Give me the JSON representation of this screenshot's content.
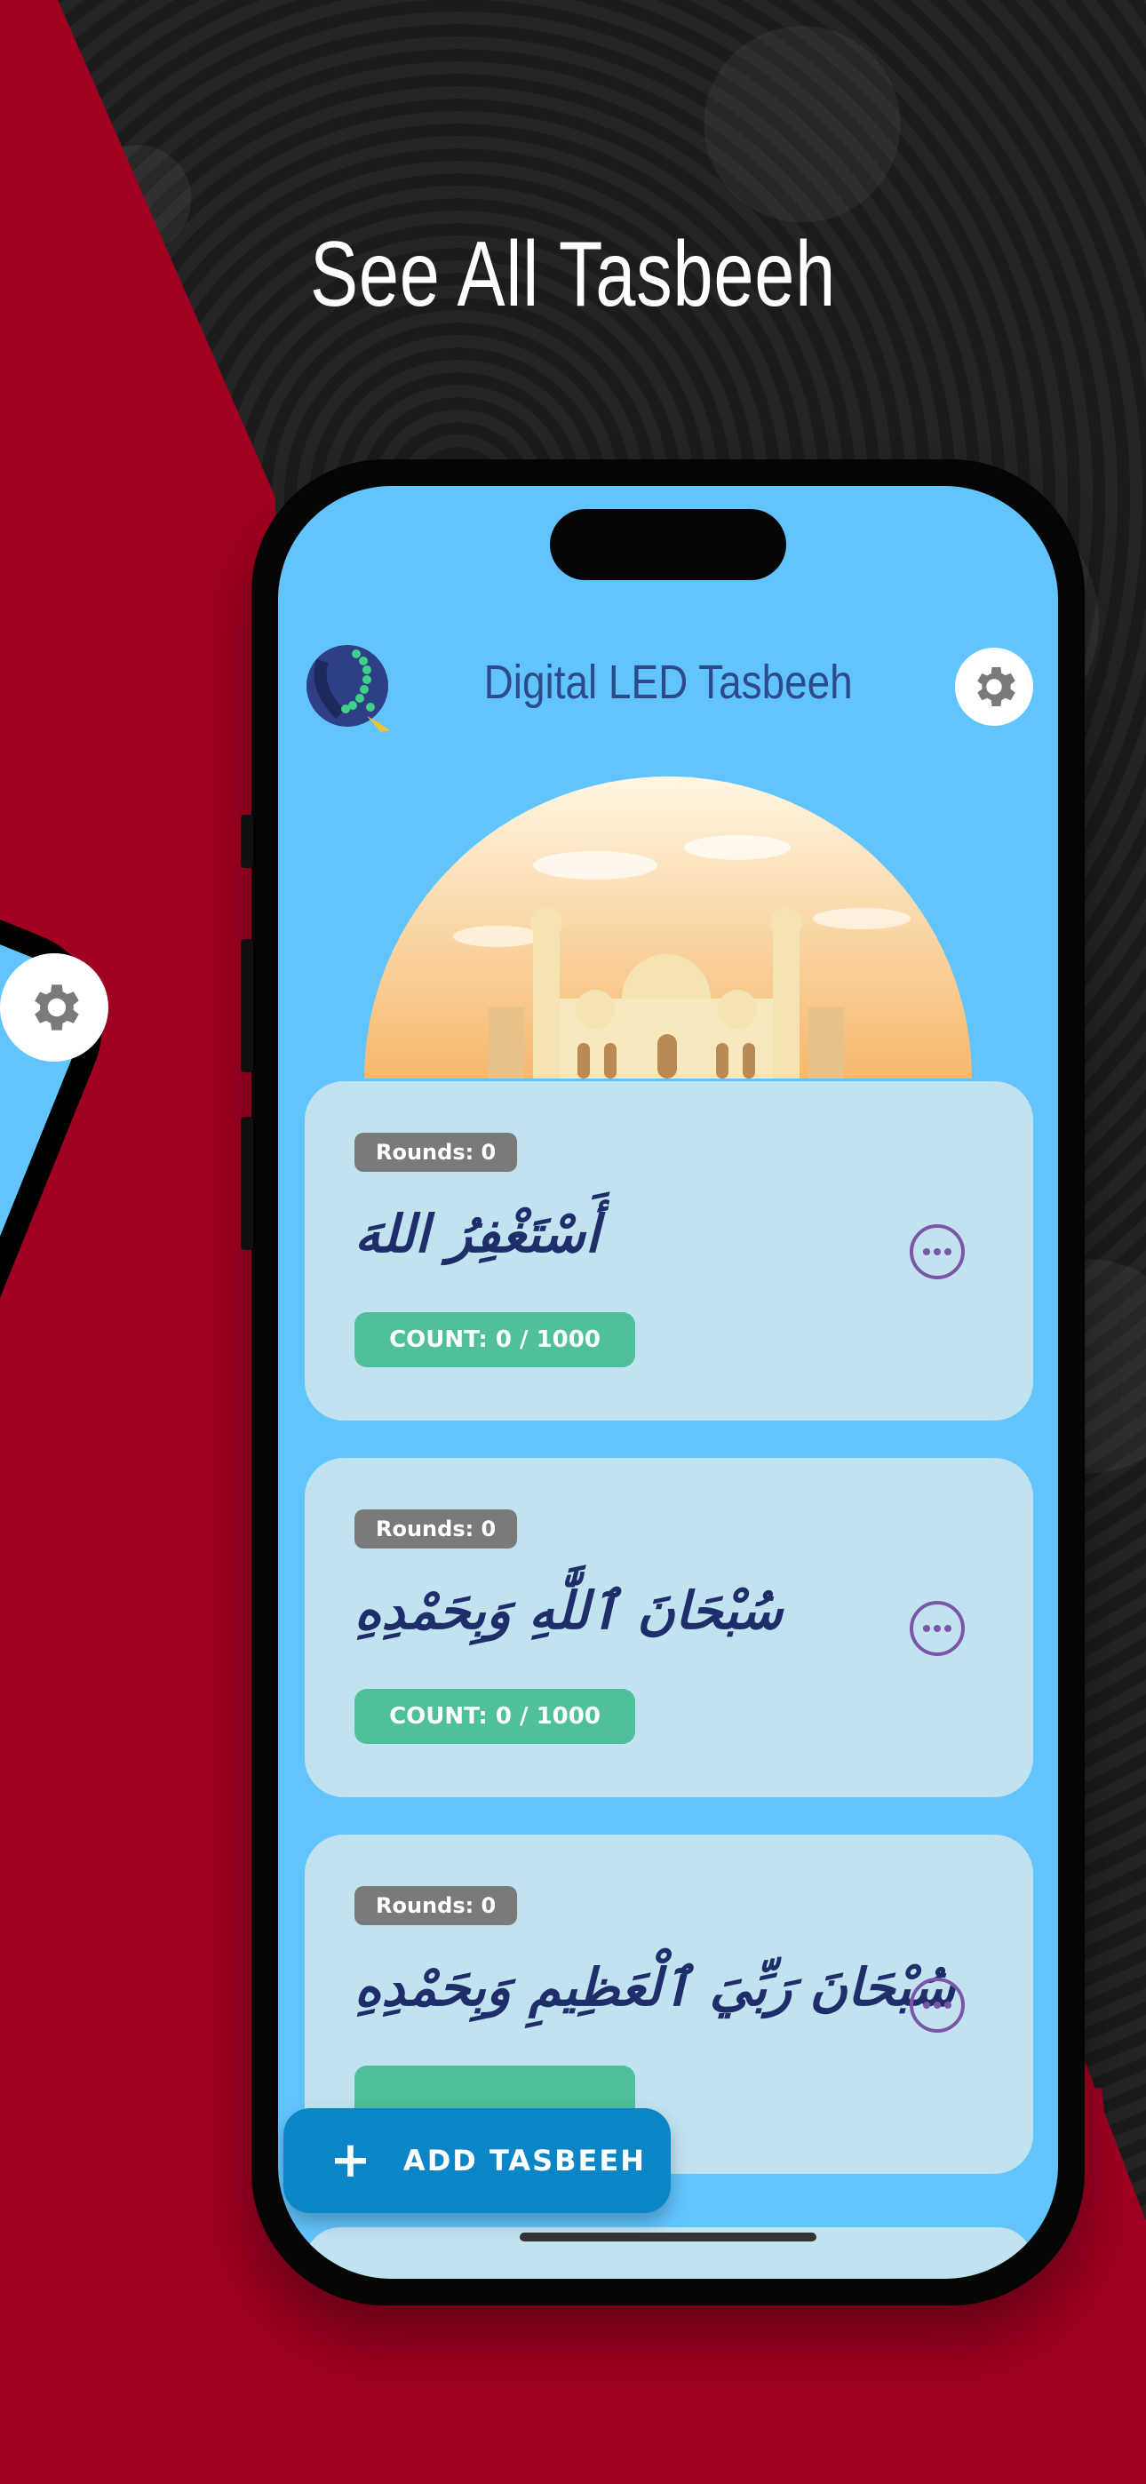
{
  "headline": "See All Tasbeeh",
  "app": {
    "title": "Digital LED Tasbeeh"
  },
  "colors": {
    "background": "#1a1a1a",
    "red_accent": "#a00021",
    "screen_bg": "#62c4fd",
    "card_bg": "#c1e3f0",
    "count_badge": "#4fbf9c",
    "fab": "#0a86c8",
    "more_icon": "#7b55a8"
  },
  "tasbeehs": [
    {
      "rounds": "Rounds: 0",
      "arabic": "أَسْتَغْفِرُ اللهَ",
      "count": "COUNT: 0 / 1000"
    },
    {
      "rounds": "Rounds: 0",
      "arabic": "سُبْحَانَ ٱللَّٰهِ وَبِحَمْدِهِ",
      "count": "COUNT: 0 / 1000"
    },
    {
      "rounds": "Rounds: 0",
      "arabic": "سُبْحَانَ رَبِّيَ ٱلْعَظِيمِ وَبِحَمْدِهِ",
      "count": ""
    }
  ],
  "fab": {
    "icon": "plus-icon",
    "label": "ADD TASBEEH"
  }
}
